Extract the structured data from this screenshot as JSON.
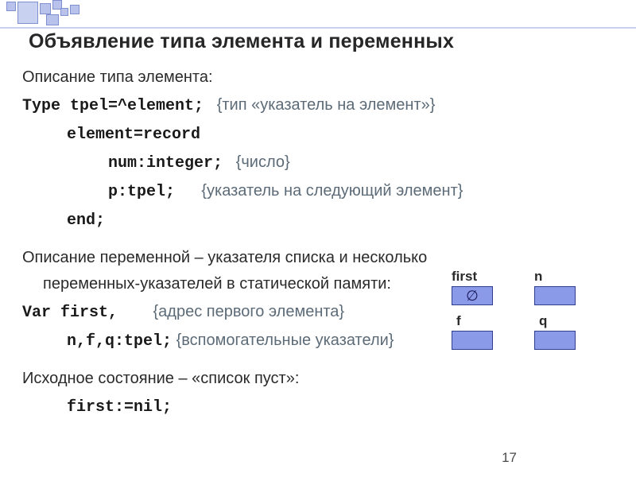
{
  "title": "Объявление типа элемента и переменных",
  "type_section": {
    "intro": "Описание типа элемента:",
    "line1_code": "Type tpel=^element;",
    "line1_cmt": "   {тип «указатель на элемент»}",
    "line2_code": "element=record",
    "line3_code": "num:integer;",
    "line3_cmt": "   {число}",
    "line4_code": "p:tpel;",
    "line4_cmt": "      {указатель на следующий элемент}",
    "line5_code": "end;"
  },
  "var_section": {
    "intro_a": "Описание переменной – указателя  списка  и несколько",
    "intro_b": "переменных-указателей в статической памяти:",
    "line1_code": "Var first,",
    "line1_cmt": "        {адрес первого элемента}",
    "line2_code": "n,f,q:tpel;",
    "line2_cmt": " {вспомогательные указатели}"
  },
  "nil_section": {
    "intro": "Исходное состояние – «список пуст»:",
    "line_code": "first:=nil;"
  },
  "diagram": {
    "first_label": "first",
    "first_value": "∅",
    "n_label": "n",
    "f_label": "f",
    "q_label": "q"
  },
  "page_number": "17"
}
